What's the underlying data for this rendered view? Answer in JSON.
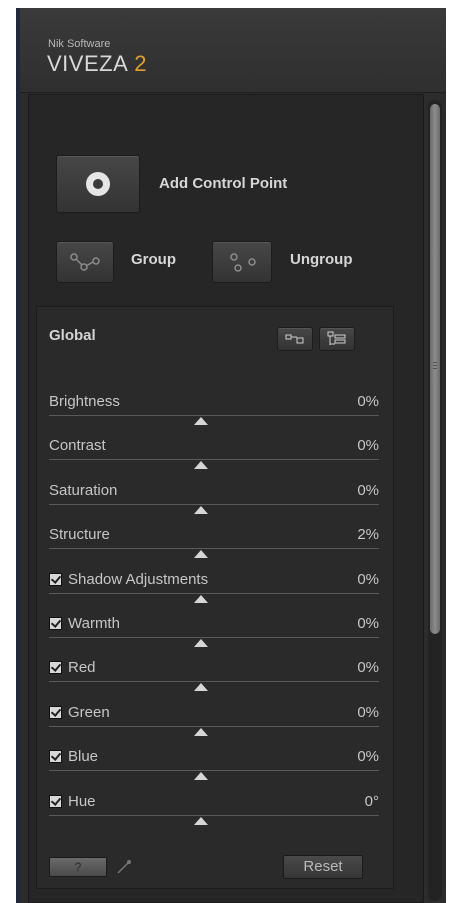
{
  "header": {
    "brand_small": "Nik Software",
    "brand_name": "VIVEZA",
    "brand_version": "2"
  },
  "actions": {
    "add_control_point": "Add Control Point",
    "group": "Group",
    "ungroup": "Ungroup"
  },
  "global": {
    "title": "Global",
    "rows": [
      {
        "label": "Brightness",
        "value": "0%",
        "checkbox": false
      },
      {
        "label": "Contrast",
        "value": "0%",
        "checkbox": false
      },
      {
        "label": "Saturation",
        "value": "0%",
        "checkbox": false
      },
      {
        "label": "Structure",
        "value": "2%",
        "checkbox": false
      },
      {
        "label": "Shadow Adjustments",
        "value": "0%",
        "checkbox": true
      },
      {
        "label": "Warmth",
        "value": "0%",
        "checkbox": true
      },
      {
        "label": "Red",
        "value": "0%",
        "checkbox": true
      },
      {
        "label": "Green",
        "value": "0%",
        "checkbox": true
      },
      {
        "label": "Blue",
        "value": "0%",
        "checkbox": true
      },
      {
        "label": "Hue",
        "value": "0°",
        "checkbox": true
      }
    ],
    "help_label": "?",
    "reset_label": "Reset"
  },
  "colors": {
    "panel_bg": "#262626",
    "accent_version": "#e0a22c",
    "text": "#c6c6c6"
  }
}
